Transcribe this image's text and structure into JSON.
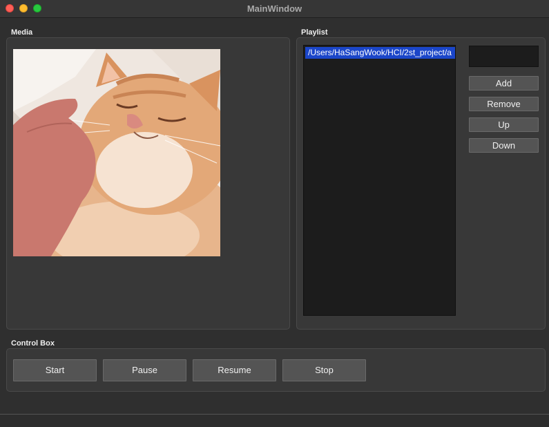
{
  "window": {
    "title": "MainWindow"
  },
  "media": {
    "label": "Media",
    "image": "cat-photo"
  },
  "playlist": {
    "label": "Playlist",
    "items": [
      {
        "path": "/Users/HaSangWook/HCI/2st_project/a"
      }
    ],
    "input_value": "",
    "buttons": {
      "add": "Add",
      "remove": "Remove",
      "up": "Up",
      "down": "Down"
    }
  },
  "control": {
    "label": "Control Box",
    "buttons": {
      "start": "Start",
      "pause": "Pause",
      "resume": "Resume",
      "stop": "Stop"
    }
  },
  "colors": {
    "window_bg": "#2f2f2f",
    "selection": "#1b46c9",
    "close": "#fe5f57",
    "minimize": "#febc2e",
    "maximize": "#28c840"
  }
}
